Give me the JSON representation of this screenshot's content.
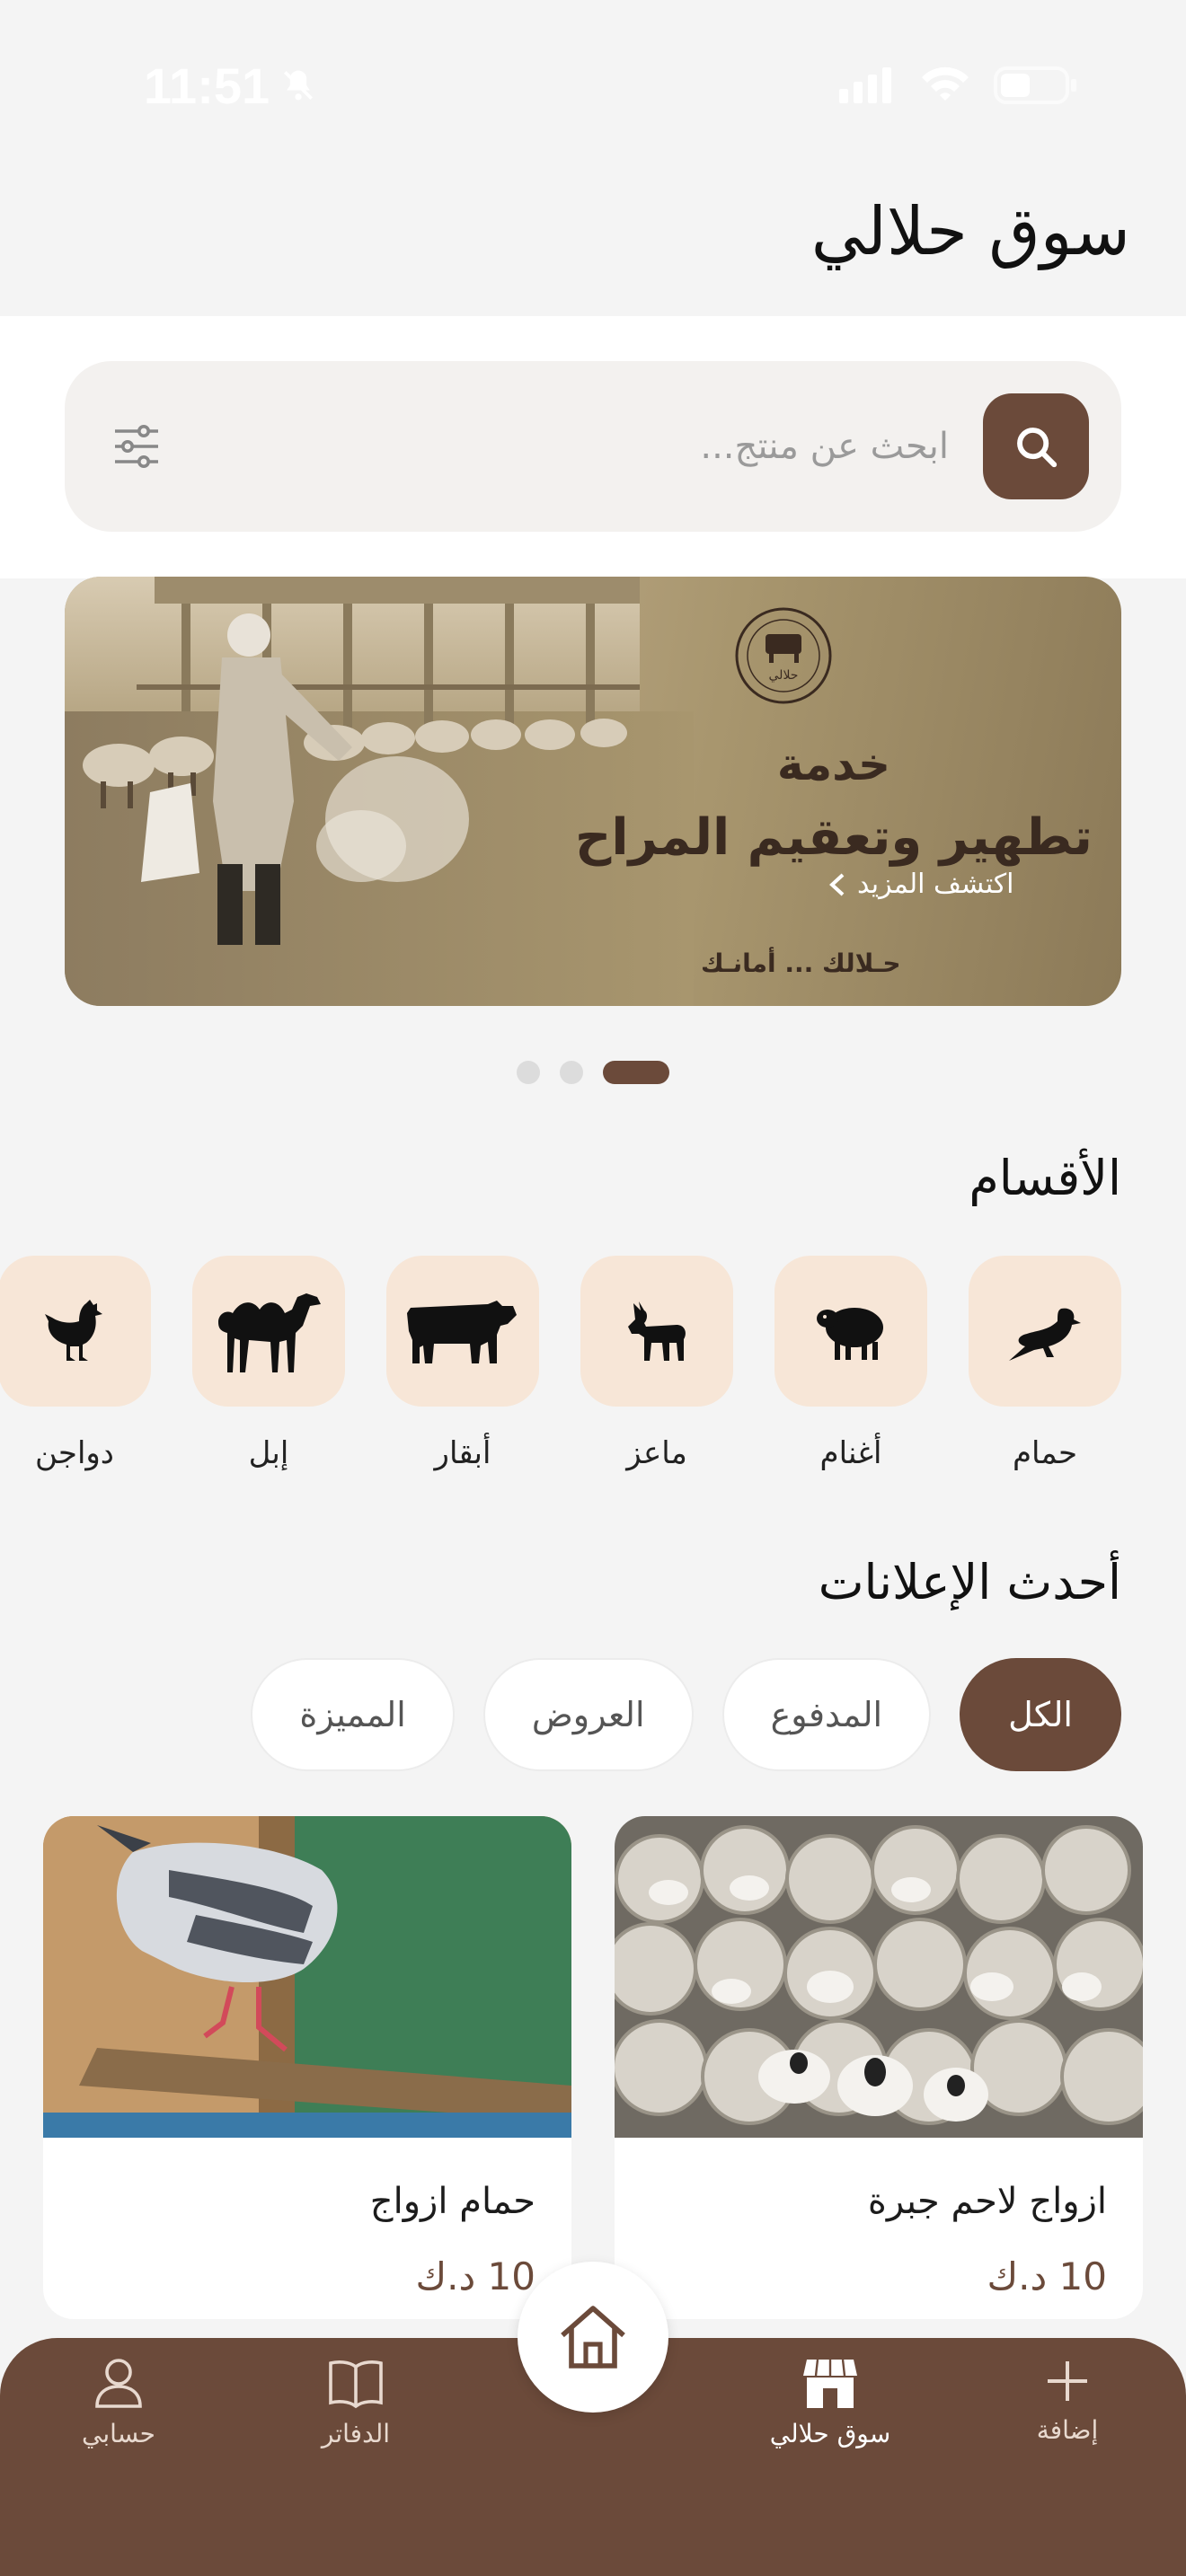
{
  "status_bar": {
    "time": "11:51"
  },
  "page_title": "سوق حلالي",
  "search": {
    "placeholder": "ابحث عن منتج..."
  },
  "banner": {
    "line1": "خدمة",
    "line2": "تطهير وتعقيم المراح",
    "more_label": "اكتشف المزيد",
    "slogan": "حـلالك ... أمانـك",
    "logo_text": "حلالي",
    "dots": {
      "count": 3,
      "active_index": 2
    }
  },
  "categories_section": {
    "title": "الأقسام",
    "items": [
      {
        "label": "حمام",
        "icon": "pigeon-icon"
      },
      {
        "label": "أغنام",
        "icon": "sheep-icon"
      },
      {
        "label": "ماعز",
        "icon": "goat-icon"
      },
      {
        "label": "أبقار",
        "icon": "cow-icon"
      },
      {
        "label": "إبل",
        "icon": "camel-icon"
      },
      {
        "label": "دواجن",
        "icon": "chicken-icon"
      }
    ]
  },
  "ads_section": {
    "title": "أحدث الإعلانات",
    "filters": [
      "الكل",
      "المدفوع",
      "العروض",
      "المميزة"
    ],
    "active_filter": "الكل",
    "cards": [
      {
        "title": "ازواج لاحم جبرة",
        "price": "10 د.ك"
      },
      {
        "title": "حمام ازواج",
        "price": "10 د.ك"
      }
    ]
  },
  "bottom_nav": {
    "items": [
      {
        "label": "إضافة",
        "icon": "plus-icon"
      },
      {
        "label": "سوق حلالي",
        "icon": "store-icon"
      },
      {
        "label": "الدفاتر",
        "icon": "book-icon"
      },
      {
        "label": "حسابي",
        "icon": "user-icon"
      }
    ],
    "active": "سوق حلالي",
    "home_icon": "home-icon"
  },
  "colors": {
    "brand": "#6b4a3a",
    "tile": "#f7e6d7",
    "background": "#f4f4f4"
  }
}
